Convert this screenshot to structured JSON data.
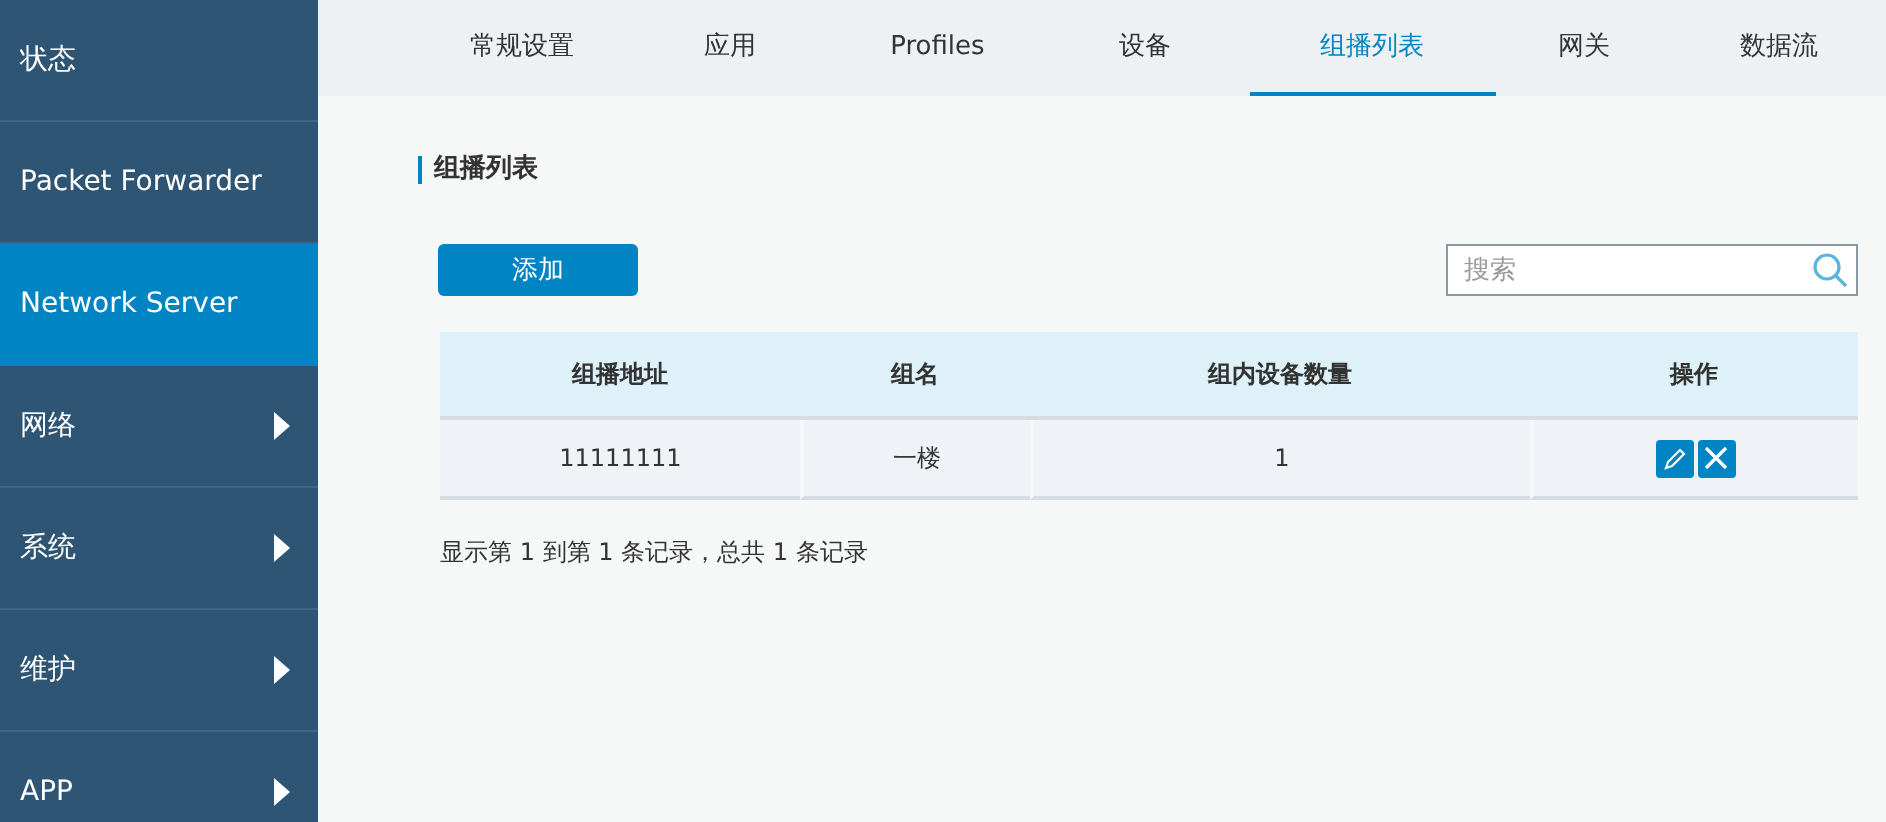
{
  "sidebar": {
    "items": [
      {
        "label": "状态",
        "kind": "link",
        "selected": false
      },
      {
        "label": "Packet Forwarder",
        "kind": "link",
        "selected": false
      },
      {
        "label": "Network Server",
        "kind": "link",
        "selected": true
      },
      {
        "label": "网络",
        "kind": "submenu",
        "selected": false
      },
      {
        "label": "系统",
        "kind": "submenu",
        "selected": false
      },
      {
        "label": "维护",
        "kind": "submenu",
        "selected": false
      },
      {
        "label": "APP",
        "kind": "submenu",
        "selected": false
      }
    ]
  },
  "tabs": [
    {
      "label": "常规设置",
      "selected": false
    },
    {
      "label": "应用",
      "selected": false
    },
    {
      "label": "Profiles",
      "selected": false
    },
    {
      "label": "设备",
      "selected": false
    },
    {
      "label": "组播列表",
      "selected": true
    },
    {
      "label": "网关",
      "selected": false
    },
    {
      "label": "数据流",
      "selected": false
    }
  ],
  "section_title": "组播列表",
  "add_button": "添加",
  "search": {
    "placeholder": "搜索"
  },
  "table": {
    "columns": [
      "组播地址",
      "组名",
      "组内设备数量",
      "操作"
    ],
    "rows": [
      {
        "cells": [
          "11111111",
          "一楼",
          "1"
        ]
      }
    ]
  },
  "footer": "显示第 1 到第 1 条记录，总共 1 条记录"
}
